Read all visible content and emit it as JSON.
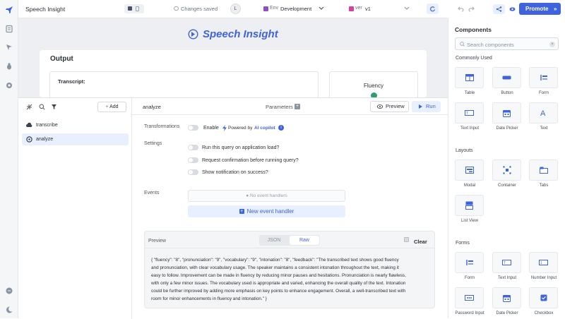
{
  "topbar": {
    "app_name": "Speech Insight",
    "save_status": "Changes saved",
    "avatar_initial": "L",
    "env_label": "Env",
    "env_value": "Development",
    "version_label": "ver",
    "version_value": "v1",
    "promote_label": "Promote"
  },
  "canvas": {
    "app_title": "Speech Insight",
    "output_title": "Output",
    "transcript_label": "Transcript:",
    "fluency_label": "Fluency"
  },
  "query_panel": {
    "add_label": "Add",
    "queries": [
      {
        "label": "transcribe"
      },
      {
        "label": "analyze"
      }
    ],
    "query_name": "analyze",
    "parameters_label": "Parameters",
    "preview_label": "Preview",
    "run_label": "Run",
    "transformations_label": "Transformations",
    "enable_label": "Enable",
    "powered_by": "Powered by",
    "ai_copilot": "AI copilot",
    "settings_label": "Settings",
    "settings": [
      "Run this query on application load?",
      "Request confirmation before running query?",
      "Show notification on success?"
    ],
    "events_label": "Events",
    "no_event_handlers": "No event handlers",
    "new_event_handler": "New event handler",
    "preview_section_label": "Preview",
    "tab_json": "JSON",
    "tab_raw": "Raw",
    "clear_label": "Clear",
    "preview_lines": [
      "{ \"fluency\": \"8\", \"pronunciation\": \"9\", \"vocabulary\": \"9\", \"intonation\": \"8\", \"feedback\": \"The transcribed text shows good fluency",
      "and pronunciation, with clear vocabulary usage. The speaker maintains a consistent intonation throughout the text, making it",
      "easy to follow. Improvement can be made in fluency by reducing minor pauses and hesitations. Pronunciation is nearly flawless,",
      "with only a few minor issues. The vocabulary used is appropriate and varied, enhancing the overall quality of the text. Intonation",
      "could be further improved by adding more emphasis on key points to enhance engagement. Overall, a well-transcribed text with",
      "room for minor enhancements in fluency and intonation.\" }"
    ]
  },
  "components_panel": {
    "title": "Components",
    "search_placeholder": "Search components",
    "commonly_used_label": "Commonly Used",
    "commonly_used": [
      {
        "label": "Table",
        "icon": "table-icon"
      },
      {
        "label": "Button",
        "icon": "button-icon"
      },
      {
        "label": "Form",
        "icon": "form-icon"
      },
      {
        "label": "Text Input",
        "icon": "text-input-icon"
      },
      {
        "label": "Date Picker",
        "icon": "date-picker-icon"
      },
      {
        "label": "Text",
        "icon": "text-icon"
      }
    ],
    "layouts_label": "Layouts",
    "layouts": [
      {
        "label": "Modal",
        "icon": "modal-icon"
      },
      {
        "label": "Container",
        "icon": "container-icon"
      },
      {
        "label": "Tabs",
        "icon": "tabs-icon"
      },
      {
        "label": "List View",
        "icon": "list-view-icon"
      }
    ],
    "forms_label": "Forms",
    "forms": [
      {
        "label": "Form",
        "icon": "form-icon"
      },
      {
        "label": "Text Input",
        "icon": "text-input-icon"
      },
      {
        "label": "Number Input",
        "icon": "number-input-icon"
      },
      {
        "label": "Password Input",
        "icon": "password-input-icon"
      },
      {
        "label": "Date Picker",
        "icon": "date-picker-icon"
      },
      {
        "label": "Checkbox",
        "icon": "checkbox-icon"
      }
    ]
  },
  "colors": {
    "accent": "#3e63dd",
    "env_accent": "#8e4ec6",
    "version_accent": "#d6409f"
  }
}
